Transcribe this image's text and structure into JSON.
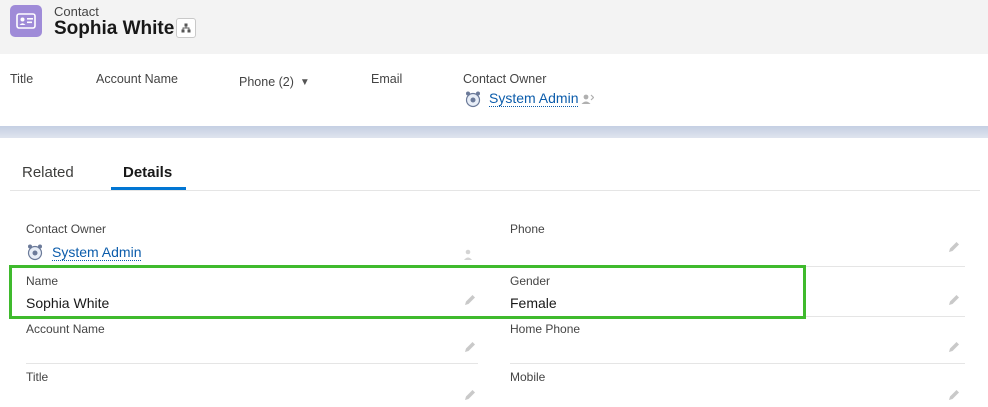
{
  "header": {
    "object_label": "Contact",
    "record_name": "Sophia White",
    "icon": "contact-card-icon",
    "hierarchy_icon": "hierarchy-icon"
  },
  "highlights": {
    "title_label": "Title",
    "account_label": "Account Name",
    "phone_label": "Phone (2)",
    "email_label": "Email",
    "owner_label": "Contact Owner",
    "owner_value": "System Admin",
    "owner_change_icon": "change-owner-icon"
  },
  "tabs": [
    {
      "label": "Related",
      "active": false
    },
    {
      "label": "Details",
      "active": true
    }
  ],
  "fields": {
    "contact_owner": {
      "label": "Contact Owner",
      "value": "System Admin"
    },
    "phone": {
      "label": "Phone",
      "value": ""
    },
    "name": {
      "label": "Name",
      "value": "Sophia White"
    },
    "gender": {
      "label": "Gender",
      "value": "Female"
    },
    "account_name": {
      "label": "Account Name",
      "value": ""
    },
    "home_phone": {
      "label": "Home Phone",
      "value": ""
    },
    "title": {
      "label": "Title",
      "value": ""
    },
    "mobile": {
      "label": "Mobile",
      "value": ""
    }
  },
  "colors": {
    "link": "#0b5cab",
    "highlight": "#3fba2d",
    "tab_active": "#0176d3",
    "object_icon": "#9f8bd8"
  }
}
